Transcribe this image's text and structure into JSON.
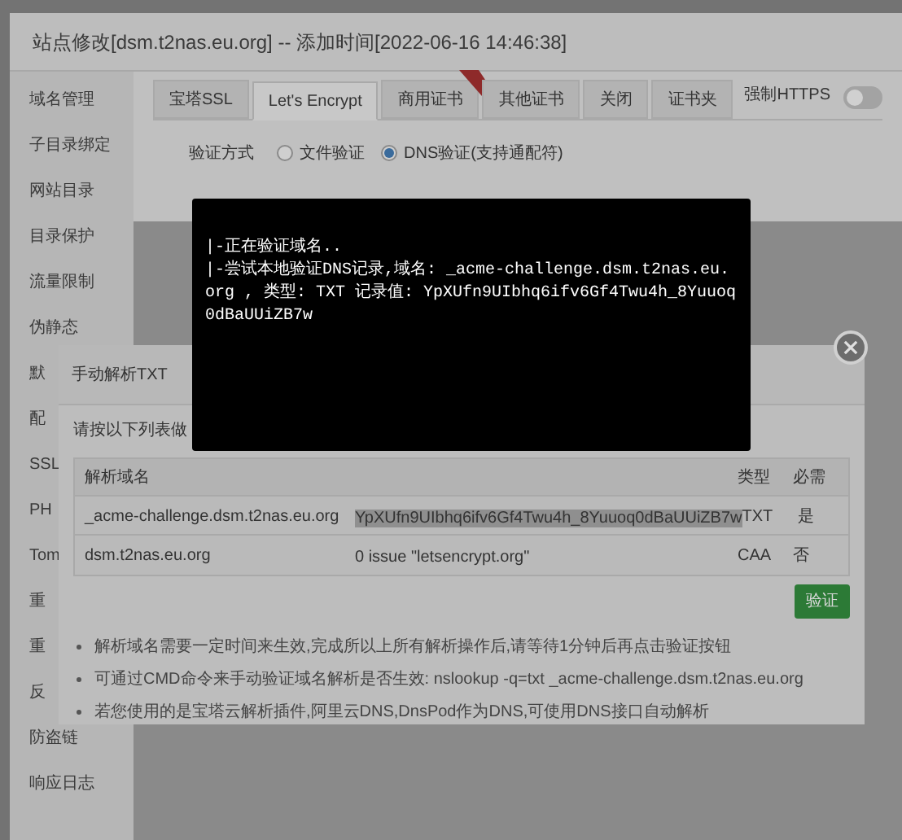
{
  "window": {
    "title": "站点修改[dsm.t2nas.eu.org] -- 添加时间[2022-06-16 14:46:38]"
  },
  "sidebar": {
    "items": [
      {
        "label": "域名管理"
      },
      {
        "label": "子目录绑定"
      },
      {
        "label": "网站目录"
      },
      {
        "label": "目录保护"
      },
      {
        "label": "流量限制"
      },
      {
        "label": "伪静态"
      },
      {
        "label": "默"
      },
      {
        "label": "配"
      },
      {
        "label": "SSL"
      },
      {
        "label": "PH"
      },
      {
        "label": "Tom"
      },
      {
        "label": "重"
      },
      {
        "label": "重"
      },
      {
        "label": "反"
      },
      {
        "label": "防盗链"
      },
      {
        "label": "响应日志"
      }
    ]
  },
  "tabs": [
    {
      "label": "宝塔SSL",
      "selected": false,
      "ribbon": false
    },
    {
      "label": "Let's Encrypt",
      "selected": true,
      "ribbon": false
    },
    {
      "label": "商用证书",
      "selected": false,
      "ribbon": true
    },
    {
      "label": "其他证书",
      "selected": false,
      "ribbon": false
    },
    {
      "label": "关闭",
      "selected": false,
      "ribbon": false
    },
    {
      "label": "证书夹",
      "selected": false,
      "ribbon": false
    }
  ],
  "force_https": {
    "label": "强制HTTPS",
    "on": false
  },
  "verify_method": {
    "label": "验证方式",
    "options": [
      {
        "label": "文件验证",
        "selected": false
      },
      {
        "label": "DNS验证(支持通配符)",
        "selected": true
      }
    ]
  },
  "dns_dialog": {
    "title": "手动解析TXT",
    "instruction": "请按以下列表做",
    "columns": [
      {
        "label": "解析域名"
      },
      {
        "label": "类型"
      },
      {
        "label": "必需"
      }
    ],
    "rows": [
      {
        "domain": "_acme-challenge.dsm.t2nas.eu.org",
        "value": "YpXUfn9UIbhq6ifv6Gf4Twu4h_8Yuuoq0dBaUUiZB7w",
        "type": "TXT",
        "required": "是",
        "value_selected": true
      },
      {
        "domain": "dsm.t2nas.eu.org",
        "value": "0 issue \"letsencrypt.org\"",
        "type": "CAA",
        "required": "否",
        "value_selected": false
      }
    ],
    "button": "验证",
    "notes": [
      "解析域名需要一定时间来生效,完成所以上所有解析操作后,请等待1分钟后再点击验证按钮",
      "可通过CMD命令来手动验证域名解析是否生效: nslookup -q=txt _acme-challenge.dsm.t2nas.eu.org",
      "若您使用的是宝塔云解析插件,阿里云DNS,DnsPod作为DNS,可使用DNS接口自动解析"
    ]
  },
  "console": {
    "lines": [
      "|-正在验证域名..",
      "|-尝试本地验证DNS记录,域名: _acme-challenge.dsm.t2nas.eu.org , 类型: TXT 记录值: YpXUfn9UIbhq6ifv6Gf4Twu4h_8Yuuoq0dBaUUiZB7w"
    ]
  }
}
